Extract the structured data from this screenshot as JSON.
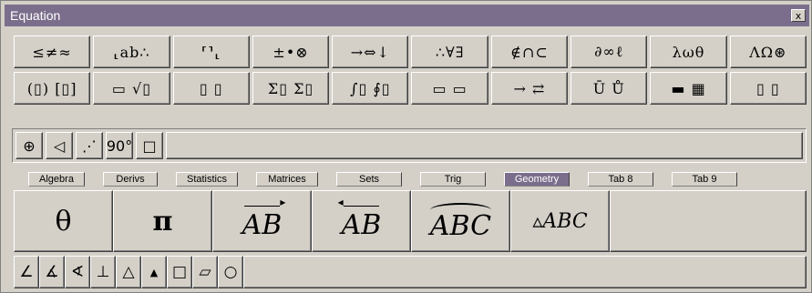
{
  "window": {
    "title": "Equation",
    "close_label": "x"
  },
  "palette_row1": [
    "≤≠≈",
    "⸤ab∴",
    "⸢⸣⸤",
    "±•⊗",
    "→⇔↓",
    "∴∀∃",
    "∉∩⊂",
    "∂∞ℓ",
    "λωθ",
    "ΛΩ⊛"
  ],
  "palette_row2": [
    "(▯) [▯]",
    "▭ √▯",
    "▯ ▯",
    "Σ▯ Σ▯",
    "∫▯ ∮▯",
    "▭ ▭",
    "→ ⇄",
    "Ū Ů",
    "▬ ▦",
    "▯ ▯"
  ],
  "toolbar": [
    "⊕",
    "◁",
    "⋰",
    "90°",
    "□"
  ],
  "tabs": [
    {
      "label": "Algebra"
    },
    {
      "label": "Derivs"
    },
    {
      "label": "Statistics"
    },
    {
      "label": "Matrices"
    },
    {
      "label": "Sets"
    },
    {
      "label": "Trig"
    },
    {
      "label": "Geometry",
      "active": true
    },
    {
      "label": "Tab 8"
    },
    {
      "label": "Tab 9"
    }
  ],
  "templates": [
    {
      "text": "θ"
    },
    {
      "text": "π"
    },
    {
      "text": "AB"
    },
    {
      "text": "AB"
    },
    {
      "text": "ABC"
    },
    {
      "text": "▵ABC"
    }
  ],
  "bottom_row": [
    "∠",
    "∡",
    "∢",
    "⊥",
    "△",
    "▲",
    "□",
    "▱",
    "○"
  ],
  "colors": {
    "title_bar": "#7b6e8c",
    "face": "#d4d0c8",
    "active_tab": "#7b6e8c"
  }
}
